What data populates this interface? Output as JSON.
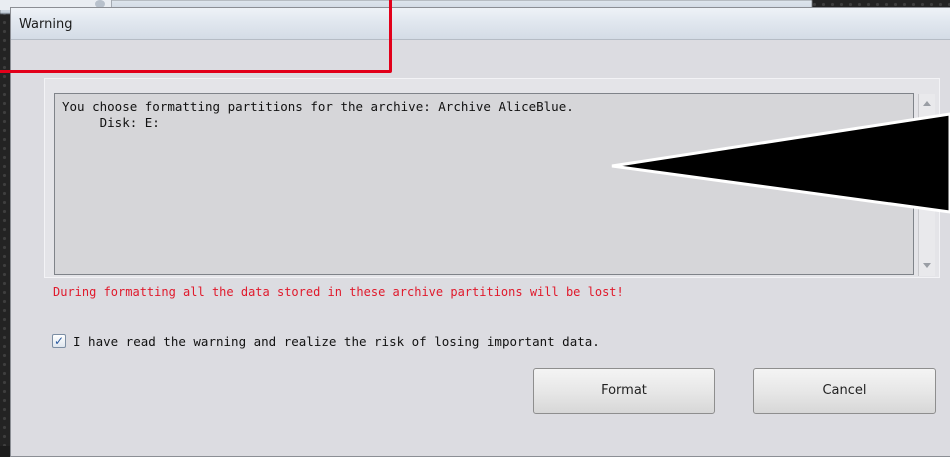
{
  "dialog": {
    "title": "Warning",
    "message_lines": [
      "You choose formatting partitions for the archive: Archive AliceBlue.",
      "     Disk: E:"
    ],
    "warning": "During formatting all the data stored in these archive partitions will be lost!",
    "acknowledge": {
      "label": "I have read the warning and realize the risk of losing important data.",
      "checked": true,
      "check_mark": "✓"
    },
    "buttons": {
      "format": "Format",
      "cancel": "Cancel"
    }
  },
  "colors": {
    "warning_text": "#e0192b",
    "annotation_rect": "#e2001a",
    "annotation_arrow": "#000000",
    "dialog_bg": "#dcdce1"
  },
  "icons": {
    "close": "close-icon",
    "checkbox": "checkmark-icon",
    "scroll_up": "scroll-up-arrow-icon",
    "scroll_down": "scroll-down-arrow-icon"
  }
}
